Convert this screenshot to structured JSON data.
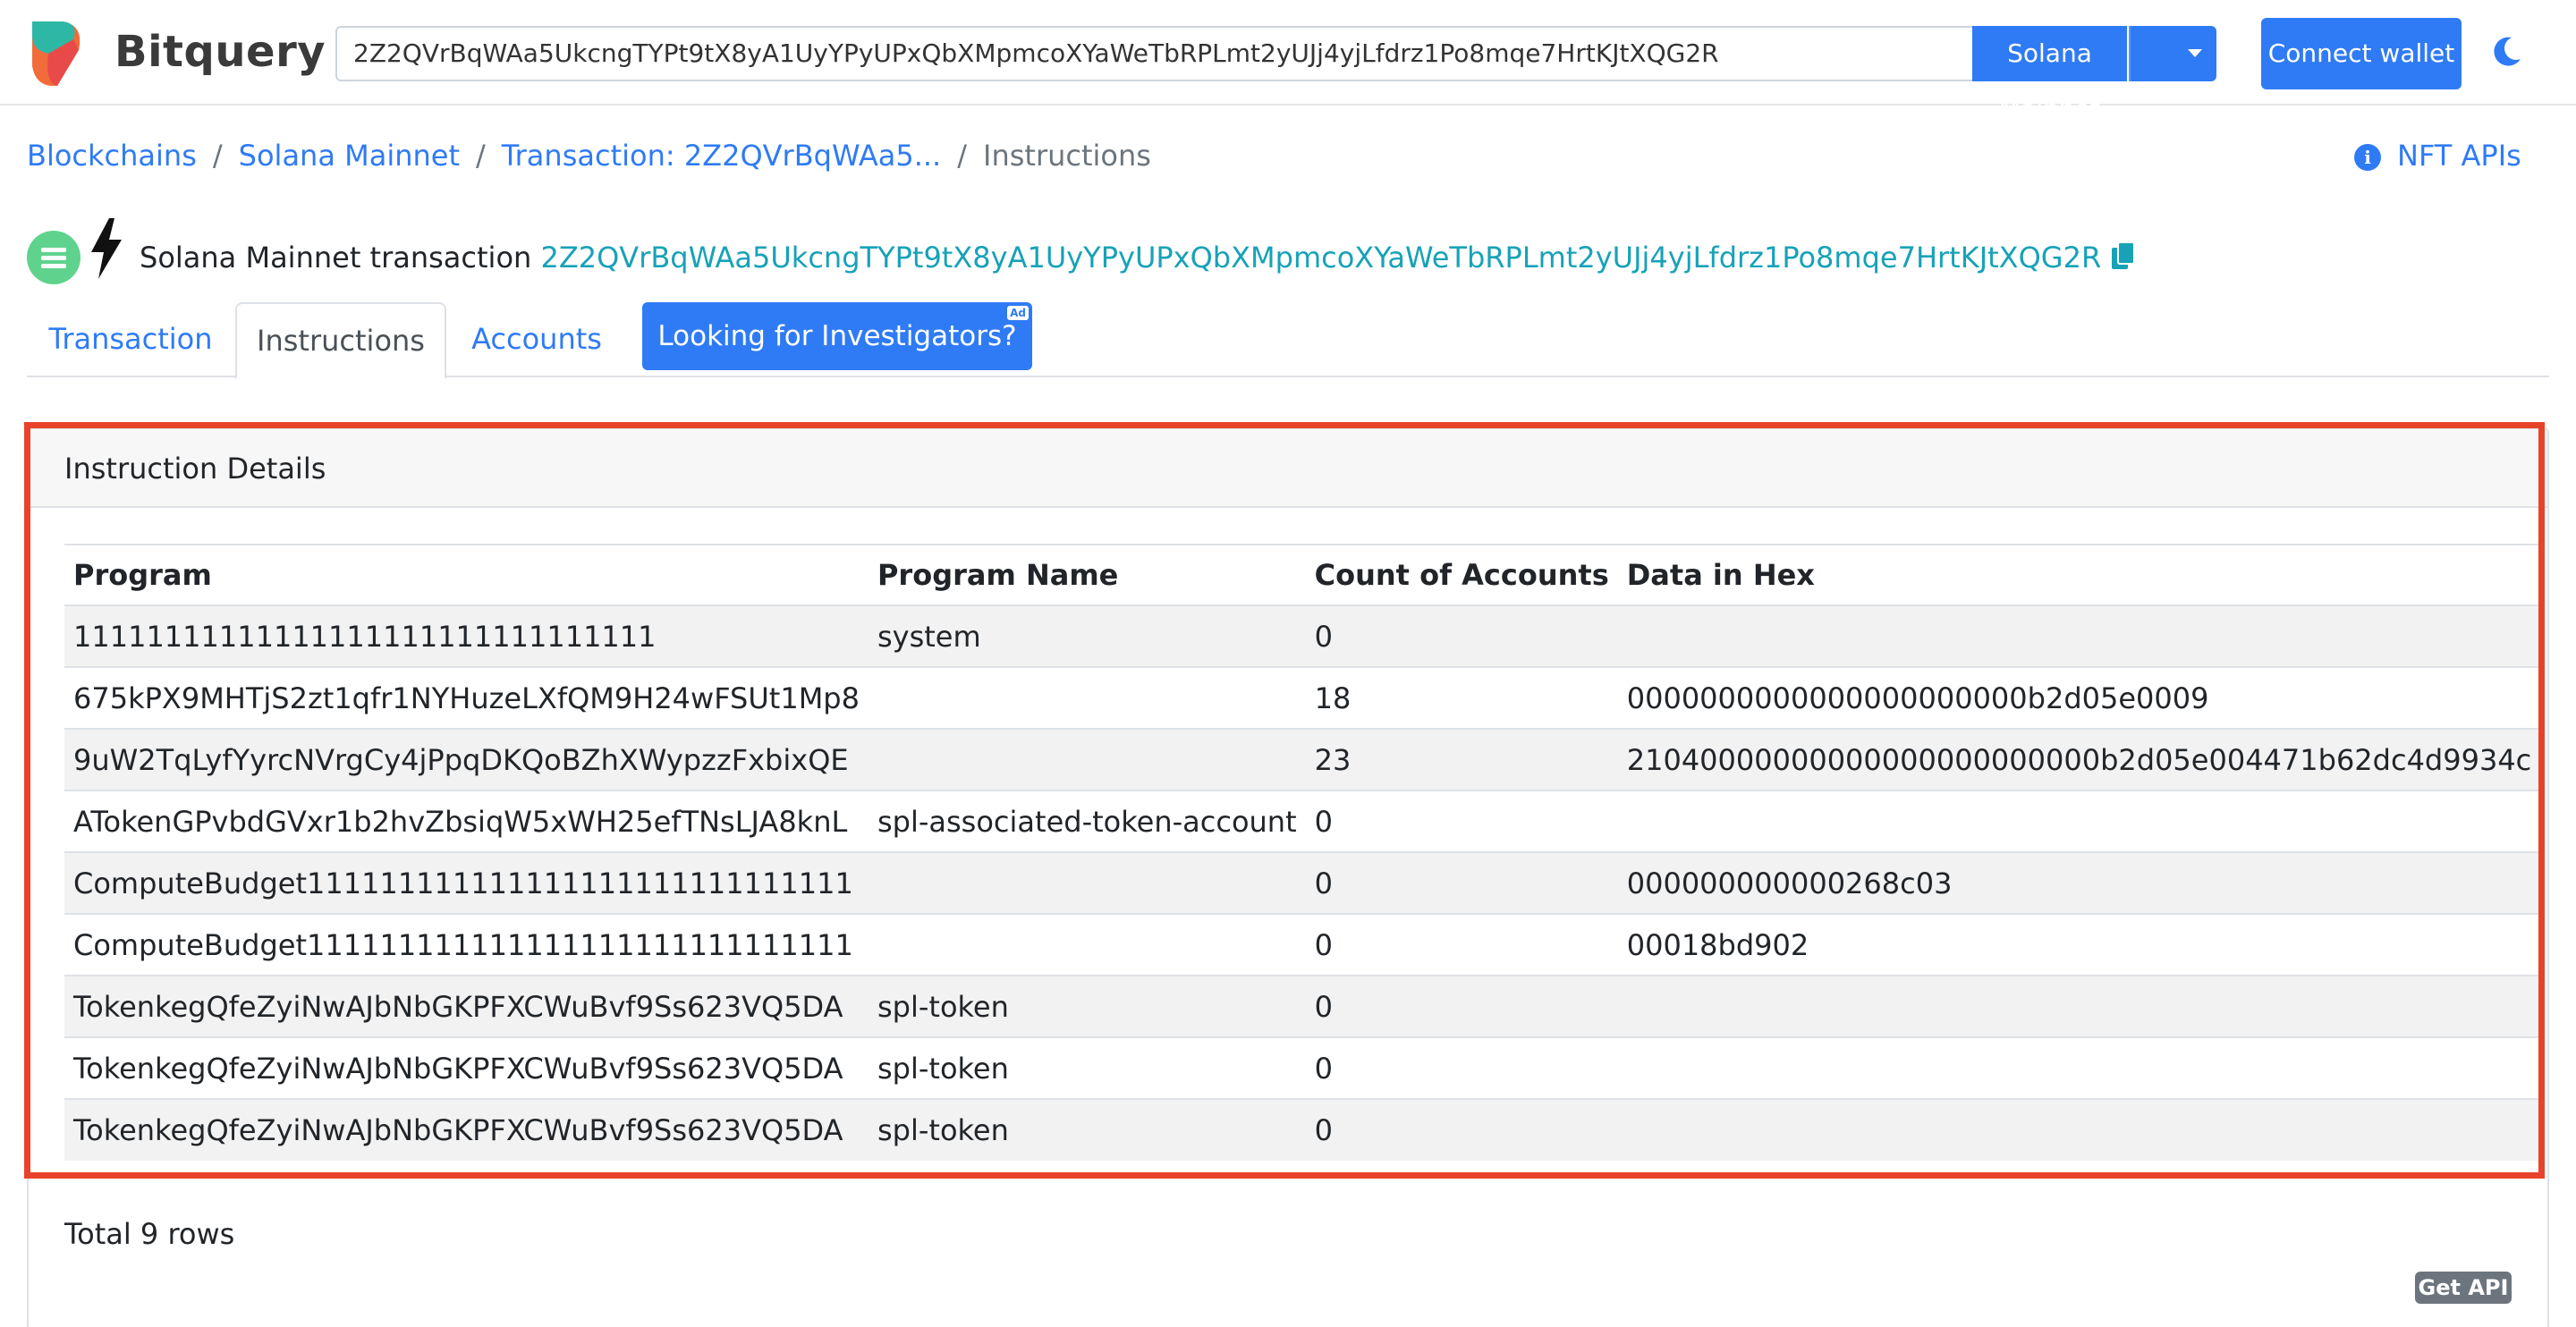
{
  "header": {
    "brand": "Bitquery",
    "search_value": "2Z2QVrBqWAa5UkcngTYPt9tX8yA1UyYPyUPxQbXMpmcoXYaWeTbRPLmt2yUJj4yjLfdrz1Po8mqe7HrtKJtXQG2R",
    "network_label": "Solana Mainnet",
    "connect_label": "Connect wallet"
  },
  "breadcrumb": {
    "items": [
      "Blockchains",
      "Solana Mainnet",
      "Transaction: 2Z2QVrBqWAa5..."
    ],
    "current": "Instructions",
    "nft_link": "NFT APIs"
  },
  "title": {
    "prefix": "Solana Mainnet transaction",
    "hash": "2Z2QVrBqWAa5UkcngTYPt9tX8yA1UyYPyUPxQbXMpmcoXYaWeTbRPLmt2yUJj4yjLfdrz1Po8mqe7HrtKJtXQG2R"
  },
  "tabs": {
    "items": [
      "Transaction",
      "Instructions",
      "Accounts"
    ],
    "active": "Instructions",
    "ad_label": "Looking for Investigators?",
    "ad_tag": "Ad"
  },
  "card": {
    "header": "Instruction Details",
    "columns": [
      "Program",
      "Program Name",
      "Count of Accounts",
      "Data in Hex"
    ],
    "rows": [
      [
        "11111111111111111111111111111111",
        "system",
        "0",
        ""
      ],
      [
        "675kPX9MHTjS2zt1qfr1NYHuzeLXfQM9H24wFSUt1Mp8",
        "",
        "18",
        "0000000000000000000000b2d05e0009"
      ],
      [
        "9uW2TqLyfYyrcNVrgCy4jPpqDKQoBZhXWypzzFxbixQE",
        "",
        "23",
        "21040000000000000000000000b2d05e004471b62dc4d9934c"
      ],
      [
        "ATokenGPvbdGVxr1b2hvZbsiqW5xWH25efTNsLJA8knL",
        "spl-associated-token-account",
        "0",
        ""
      ],
      [
        "ComputeBudget111111111111111111111111111111",
        "",
        "0",
        "000000000000268c03"
      ],
      [
        "ComputeBudget111111111111111111111111111111",
        "",
        "0",
        "00018bd902"
      ],
      [
        "TokenkegQfeZyiNwAJbNbGKPFXCWuBvf9Ss623VQ5DA",
        "spl-token",
        "0",
        ""
      ],
      [
        "TokenkegQfeZyiNwAJbNbGKPFXCWuBvf9Ss623VQ5DA",
        "spl-token",
        "0",
        ""
      ],
      [
        "TokenkegQfeZyiNwAJbNbGKPFXCWuBvf9Ss623VQ5DA",
        "spl-token",
        "0",
        ""
      ]
    ],
    "total": "Total 9 rows",
    "get_api": "Get API"
  },
  "colors": {
    "accent": "#2f7bf5",
    "hash": "#17a2b8",
    "highlight": "#e8432a"
  }
}
